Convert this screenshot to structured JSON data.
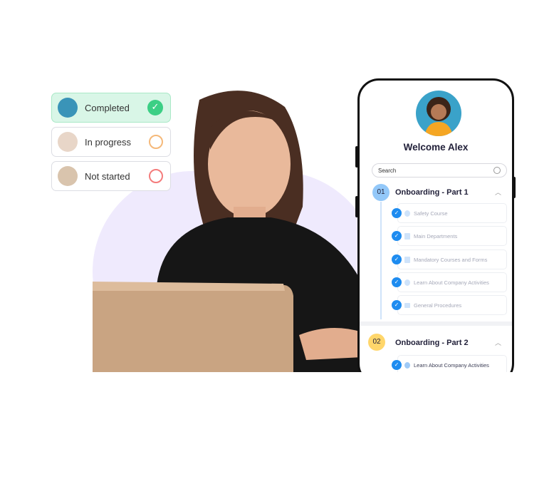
{
  "statuses": [
    {
      "label": "Completed",
      "state": "completed",
      "color": "#3ccf85"
    },
    {
      "label": "In progress",
      "state": "in-progress",
      "color": "#f5b97a"
    },
    {
      "label": "Not started",
      "state": "not-started",
      "color": "#f47c7c"
    }
  ],
  "phone": {
    "welcome": "Welcome Alex",
    "search_placeholder": "Search",
    "sections": [
      {
        "number": "01",
        "title": "Onboarding - Part 1",
        "items": [
          {
            "label": "Safety Course",
            "icon": "play-icon"
          },
          {
            "label": "Main Departments",
            "icon": "document-icon"
          },
          {
            "label": "Mandatory Courses and Forms",
            "icon": "document-icon"
          },
          {
            "label": "Learn About Company Activities",
            "icon": "play-icon"
          },
          {
            "label": "General Procedures",
            "icon": "folder-icon"
          }
        ]
      },
      {
        "number": "02",
        "title": "Onboarding - Part 2",
        "items": [
          {
            "label": "Learn About Company Activities",
            "icon": "play-icon"
          }
        ]
      }
    ]
  },
  "colors": {
    "accent": "#1e8cf0",
    "blob": "#efeafd",
    "section2": "#ffd66b"
  }
}
